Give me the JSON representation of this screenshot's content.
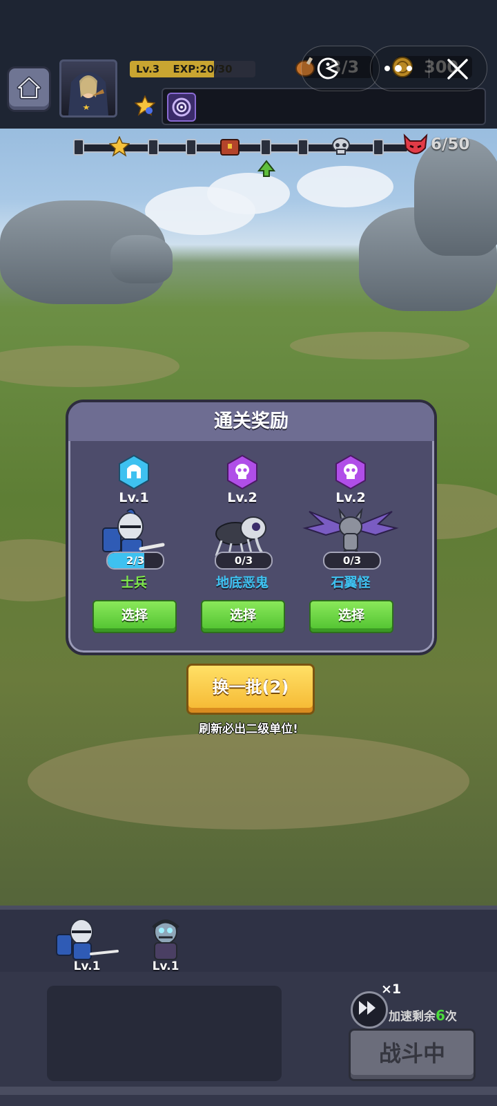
{
  "hud": {
    "level_label": "Lv.3",
    "exp_label": "EXP:20/30",
    "exp_progress": 0.67,
    "resource_a": "3/3",
    "resource_b": "300"
  },
  "stage": {
    "wave_label": "6/50",
    "current_node": 5,
    "node_count": 10
  },
  "reward": {
    "title": "通关奖励",
    "cards": [
      {
        "level": "Lv.1",
        "count": "2/3",
        "count_progress": 0.667,
        "name": "士兵",
        "name_color": "#7ee84a",
        "badge": "helmet",
        "badge_color": "#3ec1f0",
        "button": "选择"
      },
      {
        "level": "Lv.2",
        "count": "0/3",
        "count_progress": 0,
        "name": "地底恶鬼",
        "name_color": "#3ec1f0",
        "badge": "skull",
        "badge_color": "#b04ee8",
        "button": "选择"
      },
      {
        "level": "Lv.2",
        "count": "0/3",
        "count_progress": 0,
        "name": "石翼怪",
        "name_color": "#3ec1f0",
        "badge": "skull",
        "badge_color": "#b04ee8",
        "button": "选择"
      }
    ],
    "refresh_button": "换一批(2)",
    "refresh_hint": "刷新必出二级单位!"
  },
  "team": {
    "units": [
      {
        "level": "Lv.1",
        "icon": "knight-icon"
      },
      {
        "level": "Lv.1",
        "icon": "zombie-icon"
      }
    ]
  },
  "controls": {
    "speed_multiplier": "×1",
    "speed_prefix": "加速剩余",
    "speed_count": "6",
    "speed_suffix": "次",
    "battle_button": "战斗中"
  }
}
